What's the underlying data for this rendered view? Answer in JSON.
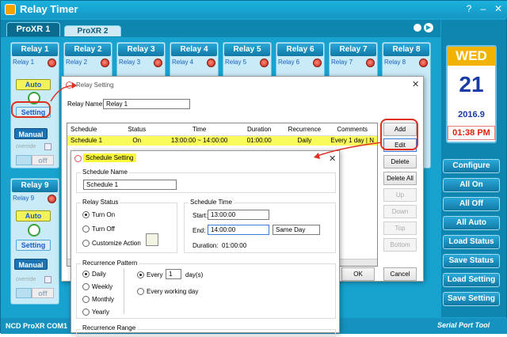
{
  "app": {
    "title": "Relay Timer",
    "status_text": "NCD ProXR COM1",
    "status_logo": "Serial Port Tool"
  },
  "window_controls": {
    "help": "?",
    "minimize": "–",
    "maximize": "□",
    "close": "✕"
  },
  "tabs": [
    {
      "label": "ProXR 1"
    },
    {
      "label": "ProXR 2"
    }
  ],
  "tab_nav": {
    "next_icon": "▶"
  },
  "relays_row1": [
    {
      "title": "Relay 1",
      "sub": "Relay 1"
    },
    {
      "title": "Relay 2",
      "sub": "Relay 2"
    },
    {
      "title": "Relay 3",
      "sub": "Relay 3"
    },
    {
      "title": "Relay 4",
      "sub": "Relay 4"
    },
    {
      "title": "Relay 5",
      "sub": "Relay 5"
    },
    {
      "title": "Relay 6",
      "sub": "Relay 6"
    },
    {
      "title": "Relay 7",
      "sub": "Relay 7"
    },
    {
      "title": "Relay 8",
      "sub": "Relay 8"
    }
  ],
  "relay9": {
    "title": "Relay 9",
    "sub": "Relay 9"
  },
  "relay_controls": {
    "auto": "Auto",
    "setting": "Setting",
    "manual": "Manual",
    "override": "override",
    "off": "off"
  },
  "calendar": {
    "day": "WED",
    "date": "21",
    "year": "2016.9",
    "time": "01:38 PM"
  },
  "side_buttons": [
    "Configure",
    "All On",
    "All Off",
    "All Auto",
    "Load Status",
    "Save Status",
    "Load Setting",
    "Save Setting"
  ],
  "relay_setting": {
    "title": "Relay Setting",
    "name_label": "Relay Name:",
    "name_value": "Relay 1",
    "columns": [
      "Schedule",
      "Status",
      "Time",
      "Duration",
      "Recurrence",
      "Comments"
    ],
    "rows": [
      {
        "schedule": "Schedule 1",
        "status": "On",
        "time": "13:00:00 ~ 14:00:00",
        "duration": "01:00:00",
        "recurrence": "Daily",
        "comments": "Every 1 day | N"
      }
    ],
    "buttons": {
      "add": "Add",
      "edit": "Edit",
      "delete": "Delete",
      "delete_all": "Delete All",
      "up": "Up",
      "down": "Down",
      "top": "Top",
      "bottom": "Bottom",
      "ok": "OK",
      "cancel": "Cancel"
    }
  },
  "schedule_setting": {
    "title": "Schedule Setting",
    "name_group": "Schedule Name",
    "name_value": "Schedule 1",
    "status_group": "Relay Status",
    "status_options": [
      "Turn On",
      "Turn Off",
      "Customize Action"
    ],
    "time_group": "Schedule Time",
    "start_label": "Start:",
    "start_value": "13:00:00",
    "end_label": "End:",
    "end_value": "14:00:00",
    "end_mode": "Same Day",
    "duration_label": "Duration:",
    "duration_value": "01:00:00",
    "recurrence_group": "Recurrence Pattern",
    "recurrence_options": [
      "Daily",
      "Weekly",
      "Monthly",
      "Yearly"
    ],
    "every_label": "Every",
    "every_value": "1",
    "every_unit": "day(s)",
    "every_working_day": "Every working day",
    "range_group": "Recurrence Range"
  },
  "colors": {
    "accent": "#1597c3",
    "highlight_row": "#fafa5a",
    "annotation": "#e03020",
    "time_red": "#e0200a"
  }
}
